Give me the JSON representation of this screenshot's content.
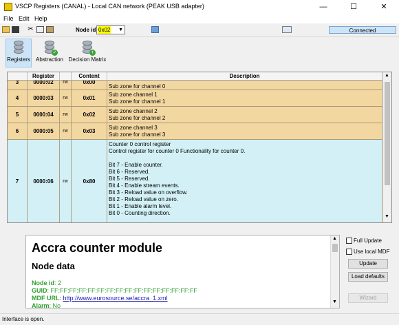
{
  "window": {
    "title": "VSCP Registers (CANAL) - Local CAN network (PEAK USB adapter)",
    "minimize": "—",
    "maximize": "☐",
    "close": "✕"
  },
  "menu": [
    "File",
    "Edit",
    "Help"
  ],
  "toolbar": {
    "node_id_label": "Node id:",
    "node_id_value": "0x02",
    "connection_status": "Connected",
    "icons": [
      "open-icon",
      "save-icon",
      "cut-icon",
      "copy-icon",
      "paste-icon",
      "print-icon",
      "search-icon"
    ]
  },
  "views": {
    "registers": "Registers",
    "abstraction": "Abstraction",
    "decision_matrix": "Decision Matrix"
  },
  "table": {
    "headers": [
      "",
      "Register",
      "",
      "Content",
      "Description"
    ],
    "rows": [
      {
        "idx": "3",
        "reg": "0000:02",
        "acc": "rw",
        "content": "0x00",
        "desc": "Sub zone for channel 0"
      },
      {
        "idx": "4",
        "reg": "0000:03",
        "acc": "rw",
        "content": "0x01",
        "desc": "Sub zone channel 1\nSub zone for channel 1"
      },
      {
        "idx": "5",
        "reg": "0000:04",
        "acc": "rw",
        "content": "0x02",
        "desc": "Sub zone channel 2\nSub zone for channel 2"
      },
      {
        "idx": "6",
        "reg": "0000:05",
        "acc": "rw",
        "content": "0x03",
        "desc": "Sub zone channel 3\nSub zone for channel 3"
      },
      {
        "idx": "7",
        "reg": "0000:06",
        "acc": "rw",
        "content": "0x80",
        "desc": "Counter 0 control register\nControl register for counter 0 Functionality for counter 0.\n\nBit 7 - Enable counter.\nBit 6 - Reserved.\nBit 5 - Reserved.\nBit 4 - Enable stream events.\nBit 3 - Reload value on overflow.\nBit 2 - Reload value on zero.\nBit 1 - Enable alarm level.\nBit 0 - Counting direction."
      }
    ],
    "colors": {
      "zone": "#f3d7a1",
      "counter": "#d2f0f5"
    }
  },
  "info": {
    "title": "Accra counter module",
    "subtitle": "Node data",
    "node_id_label": "Node id",
    "node_id_value": ": 2",
    "guid_label": "GUID",
    "guid_value": ": FF:FF:FF:FF:FF:FF:FF:FF:FF:FF:FF:FF:FF:FF:FF:FF",
    "mdf_label": "MDF URL",
    "mdf_value": "http://www.eurosource.se/accra_1.xml",
    "alarm_label": "Alarm",
    "alarm_value": ": No"
  },
  "controls": {
    "full_update": "Full Update",
    "use_local_mdf": "Use local MDF",
    "update": "Update",
    "load_defaults": "Load defaults",
    "wizard": "Wizard"
  },
  "status": "Interface is open."
}
